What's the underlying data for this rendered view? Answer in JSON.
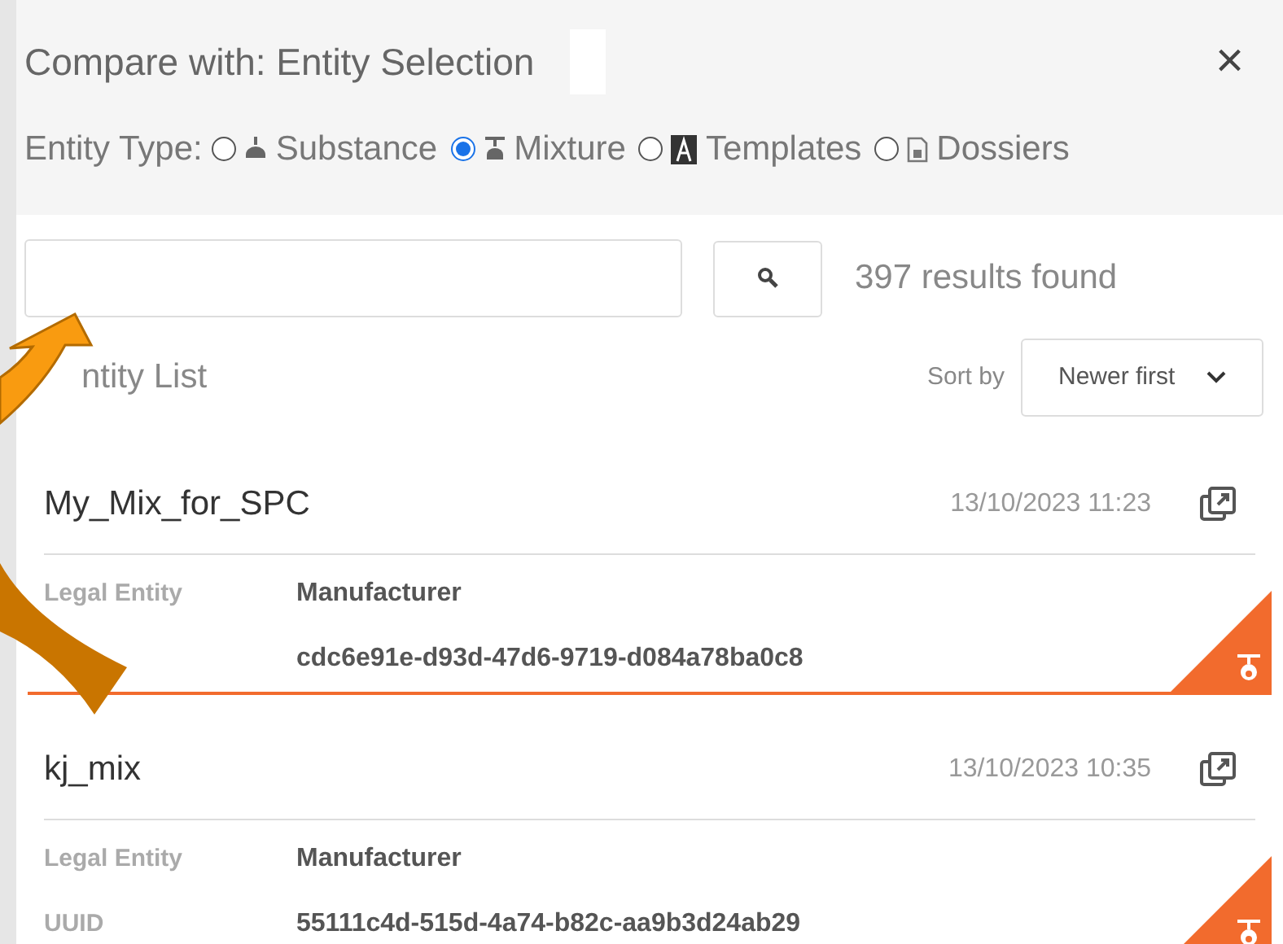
{
  "dialog": {
    "title": "Compare with: Entity Selection",
    "close": "×"
  },
  "entity_type": {
    "label": "Entity Type:",
    "options": [
      {
        "label": "Substance",
        "kind": "substance",
        "selected": false
      },
      {
        "label": "Mixture",
        "kind": "mixture",
        "selected": true
      },
      {
        "label": "Templates",
        "kind": "templates",
        "selected": false
      },
      {
        "label": "Dossiers",
        "kind": "dossiers",
        "selected": false
      }
    ]
  },
  "search": {
    "results": "397 results found"
  },
  "list": {
    "heading": "ntity List",
    "sort_label": "Sort by",
    "sort_value": "Newer first"
  },
  "entities": [
    {
      "name": "My_Mix_for_SPC",
      "date": "13/10/2023 11:23",
      "selected": true,
      "fields": [
        {
          "label": "Legal Entity",
          "value": "Manufacturer"
        },
        {
          "value": "cdc6e91e-d93d-47d6-9719-d084a78ba0c8"
        }
      ]
    },
    {
      "name": "kj_mix",
      "date": "13/10/2023 10:35",
      "fields": [
        {
          "label": "Legal Entity",
          "value": "Manufacturer"
        },
        {
          "label": "UUID",
          "value": "55111c4d-515d-4a74-b82c-aa9b3d24ab29"
        }
      ]
    }
  ]
}
